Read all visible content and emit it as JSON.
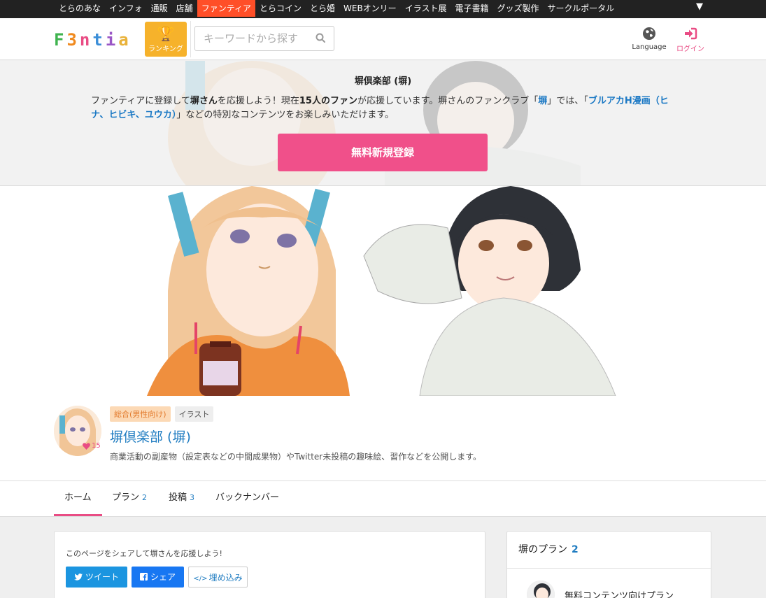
{
  "topnav": {
    "items": [
      "とらのあな",
      "インフォ",
      "通販",
      "店舗",
      "ファンティア",
      "とらコイン",
      "とら婚",
      "WEBオンリー",
      "イラスト展",
      "電子書籍",
      "グッズ製作",
      "サークルポータル"
    ],
    "active_index": 4,
    "more_glyph": "▼"
  },
  "header": {
    "logo_letters": [
      "F",
      "3",
      "n",
      "t",
      "i",
      "a"
    ],
    "logo_colors": [
      "#3fb34f",
      "#f08a1e",
      "#e94c84",
      "#3b8ed8",
      "#9a56c6",
      "#e9b23a"
    ],
    "ranking_label": "ランキング",
    "search_placeholder": "キーワードから探す",
    "language_label": "Language",
    "login_label": "ログイン"
  },
  "banner": {
    "title": "塀倶楽部 (塀)",
    "msg_part1": "ファンティアに登録して",
    "msg_creator": "塀さん",
    "msg_part2": "を応援しよう！現在",
    "msg_fans": "15人のファン",
    "msg_part3": "が応援しています。塀さんのファンクラブ「",
    "msg_club": "塀",
    "msg_part4": "」では、「",
    "msg_content": "ブルアカH漫画（ヒナ、ヒビキ、ユウカ）",
    "msg_part5": "」などの特別なコンテンツをお楽しみいただけます。",
    "register_label": "無料新規登録"
  },
  "profile": {
    "fan_count": "15",
    "tags": [
      "総合(男性向け)",
      "イラスト"
    ],
    "name": "塀倶楽部 (塀)",
    "description": "商業活動の副産物（設定表などの中間成果物）やTwitter未投稿の趣味絵、習作などを公開します。"
  },
  "tabs": [
    {
      "label": "ホーム",
      "count": ""
    },
    {
      "label": "プラン",
      "count": "2"
    },
    {
      "label": "投稿",
      "count": "3"
    },
    {
      "label": "バックナンバー",
      "count": ""
    }
  ],
  "share": {
    "text": "このページをシェアして塀さんを応援しよう!",
    "tweet_label": "ツイート",
    "facebook_label": "シェア",
    "embed_label": "埋め込み"
  },
  "plans": {
    "heading": "塀のプラン",
    "count": "2",
    "first_plan_name": "無料コンテンツ向けプラン"
  },
  "colors": {
    "accent_pink": "#f0508a",
    "link_blue": "#1f7cc1",
    "ranking_yellow": "#f6b22b",
    "topnav_active": "#ff4f28"
  }
}
